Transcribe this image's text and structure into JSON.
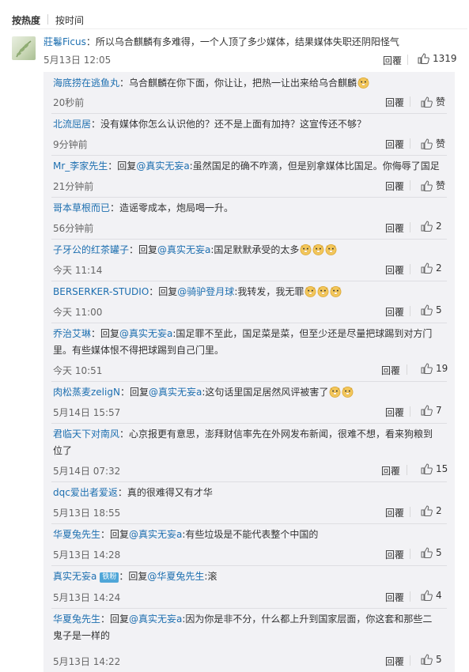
{
  "tabs": {
    "hot": "按热度",
    "time": "按时间"
  },
  "actions": {
    "reply": "回覆"
  },
  "root": {
    "user": "莊鬈Ficus",
    "text": "：所以乌合麒麟有多难得，一个人顶了多少媒体，结果媒体失职还阴阳怪气",
    "time": "5月13日 12:05",
    "likes": "1319"
  },
  "replies": [
    {
      "user": "海底捞在逃鱼丸",
      "text": "：乌合麒麟在你下面，你让让，把热一让出来给乌合麒麟",
      "time": "20秒前",
      "likes": "赞"
    },
    {
      "user": "北流屈居",
      "text": "：没有媒体你怎么认识他的？还不是上面有加持？这宣传还不够？",
      "time": "9分钟前",
      "likes": "赞"
    },
    {
      "user": "Mr_李家先生",
      "prefix": "：回复",
      "mention": "@真实无妄a",
      "text": ":虽然国足的确不咋滴，但是别拿媒体比国足。你侮辱了国足",
      "time": "21分钟前",
      "likes": "赞"
    },
    {
      "user": "哥本草根而已",
      "text": "：造谣零成本，炮局喝一升。",
      "time": "56分钟前",
      "likes": "2"
    },
    {
      "user": "子牙公的红茶罐子",
      "prefix": "：回复",
      "mention": "@真实无妄a",
      "text": ":国足默默承受的太多",
      "time": "今天 11:14",
      "likes": "2"
    },
    {
      "user": "BERSERKER-STUDIO",
      "prefix": "：回复",
      "mention": "@骑驴登月球",
      "text": ":我转发，我无罪",
      "time": "今天 11:00",
      "likes": "5"
    },
    {
      "user": "乔治艾琳",
      "prefix": "：回复",
      "mention": "@真实无妄a",
      "text": ":国足罪不至此，国足菜是菜，但至少还是尽量把球踢到对方门里。有些媒体恨不得把球踢到自己门里。",
      "time": "今天 10:51",
      "likes": "19"
    },
    {
      "user": "肉松蒸麦zeligN",
      "prefix": "：回复",
      "mention": "@真实无妄a",
      "text": ":这句话里国足居然风评被害了",
      "time": "5月14日 15:57",
      "likes": "7"
    },
    {
      "user": "君临天下对南风",
      "text": "：心京报更有意思，澎拜财信率先在外网发布新闻，很难不想，看来狗粮到位了",
      "time": "5月14日 07:32",
      "likes": "15"
    },
    {
      "user": "dqc爱出者爱返",
      "text": "：真的很难得又有才华",
      "time": "5月13日 18:55",
      "likes": "2"
    },
    {
      "user": "华夏兔先生",
      "prefix": "：回复",
      "mention": "@真实无妄a",
      "text": ":有些垃圾是不能代表整个中国的",
      "time": "5月13日 14:28",
      "likes": "5"
    },
    {
      "user": "真实无妄a",
      "badge": "铁粉",
      "prefix": "：回复",
      "mention": "@华夏兔先生",
      "text": ":滚",
      "time": "5月13日 14:24",
      "likes": "4"
    },
    {
      "user": "华夏兔先生",
      "prefix": "：回复",
      "mention": "@真实无妄a",
      "text": ":因为你是非不分，什么都上升到国家层面，你这套和那些二鬼子是一样的",
      "time": "5月13日 14:22",
      "likes": "5"
    }
  ]
}
